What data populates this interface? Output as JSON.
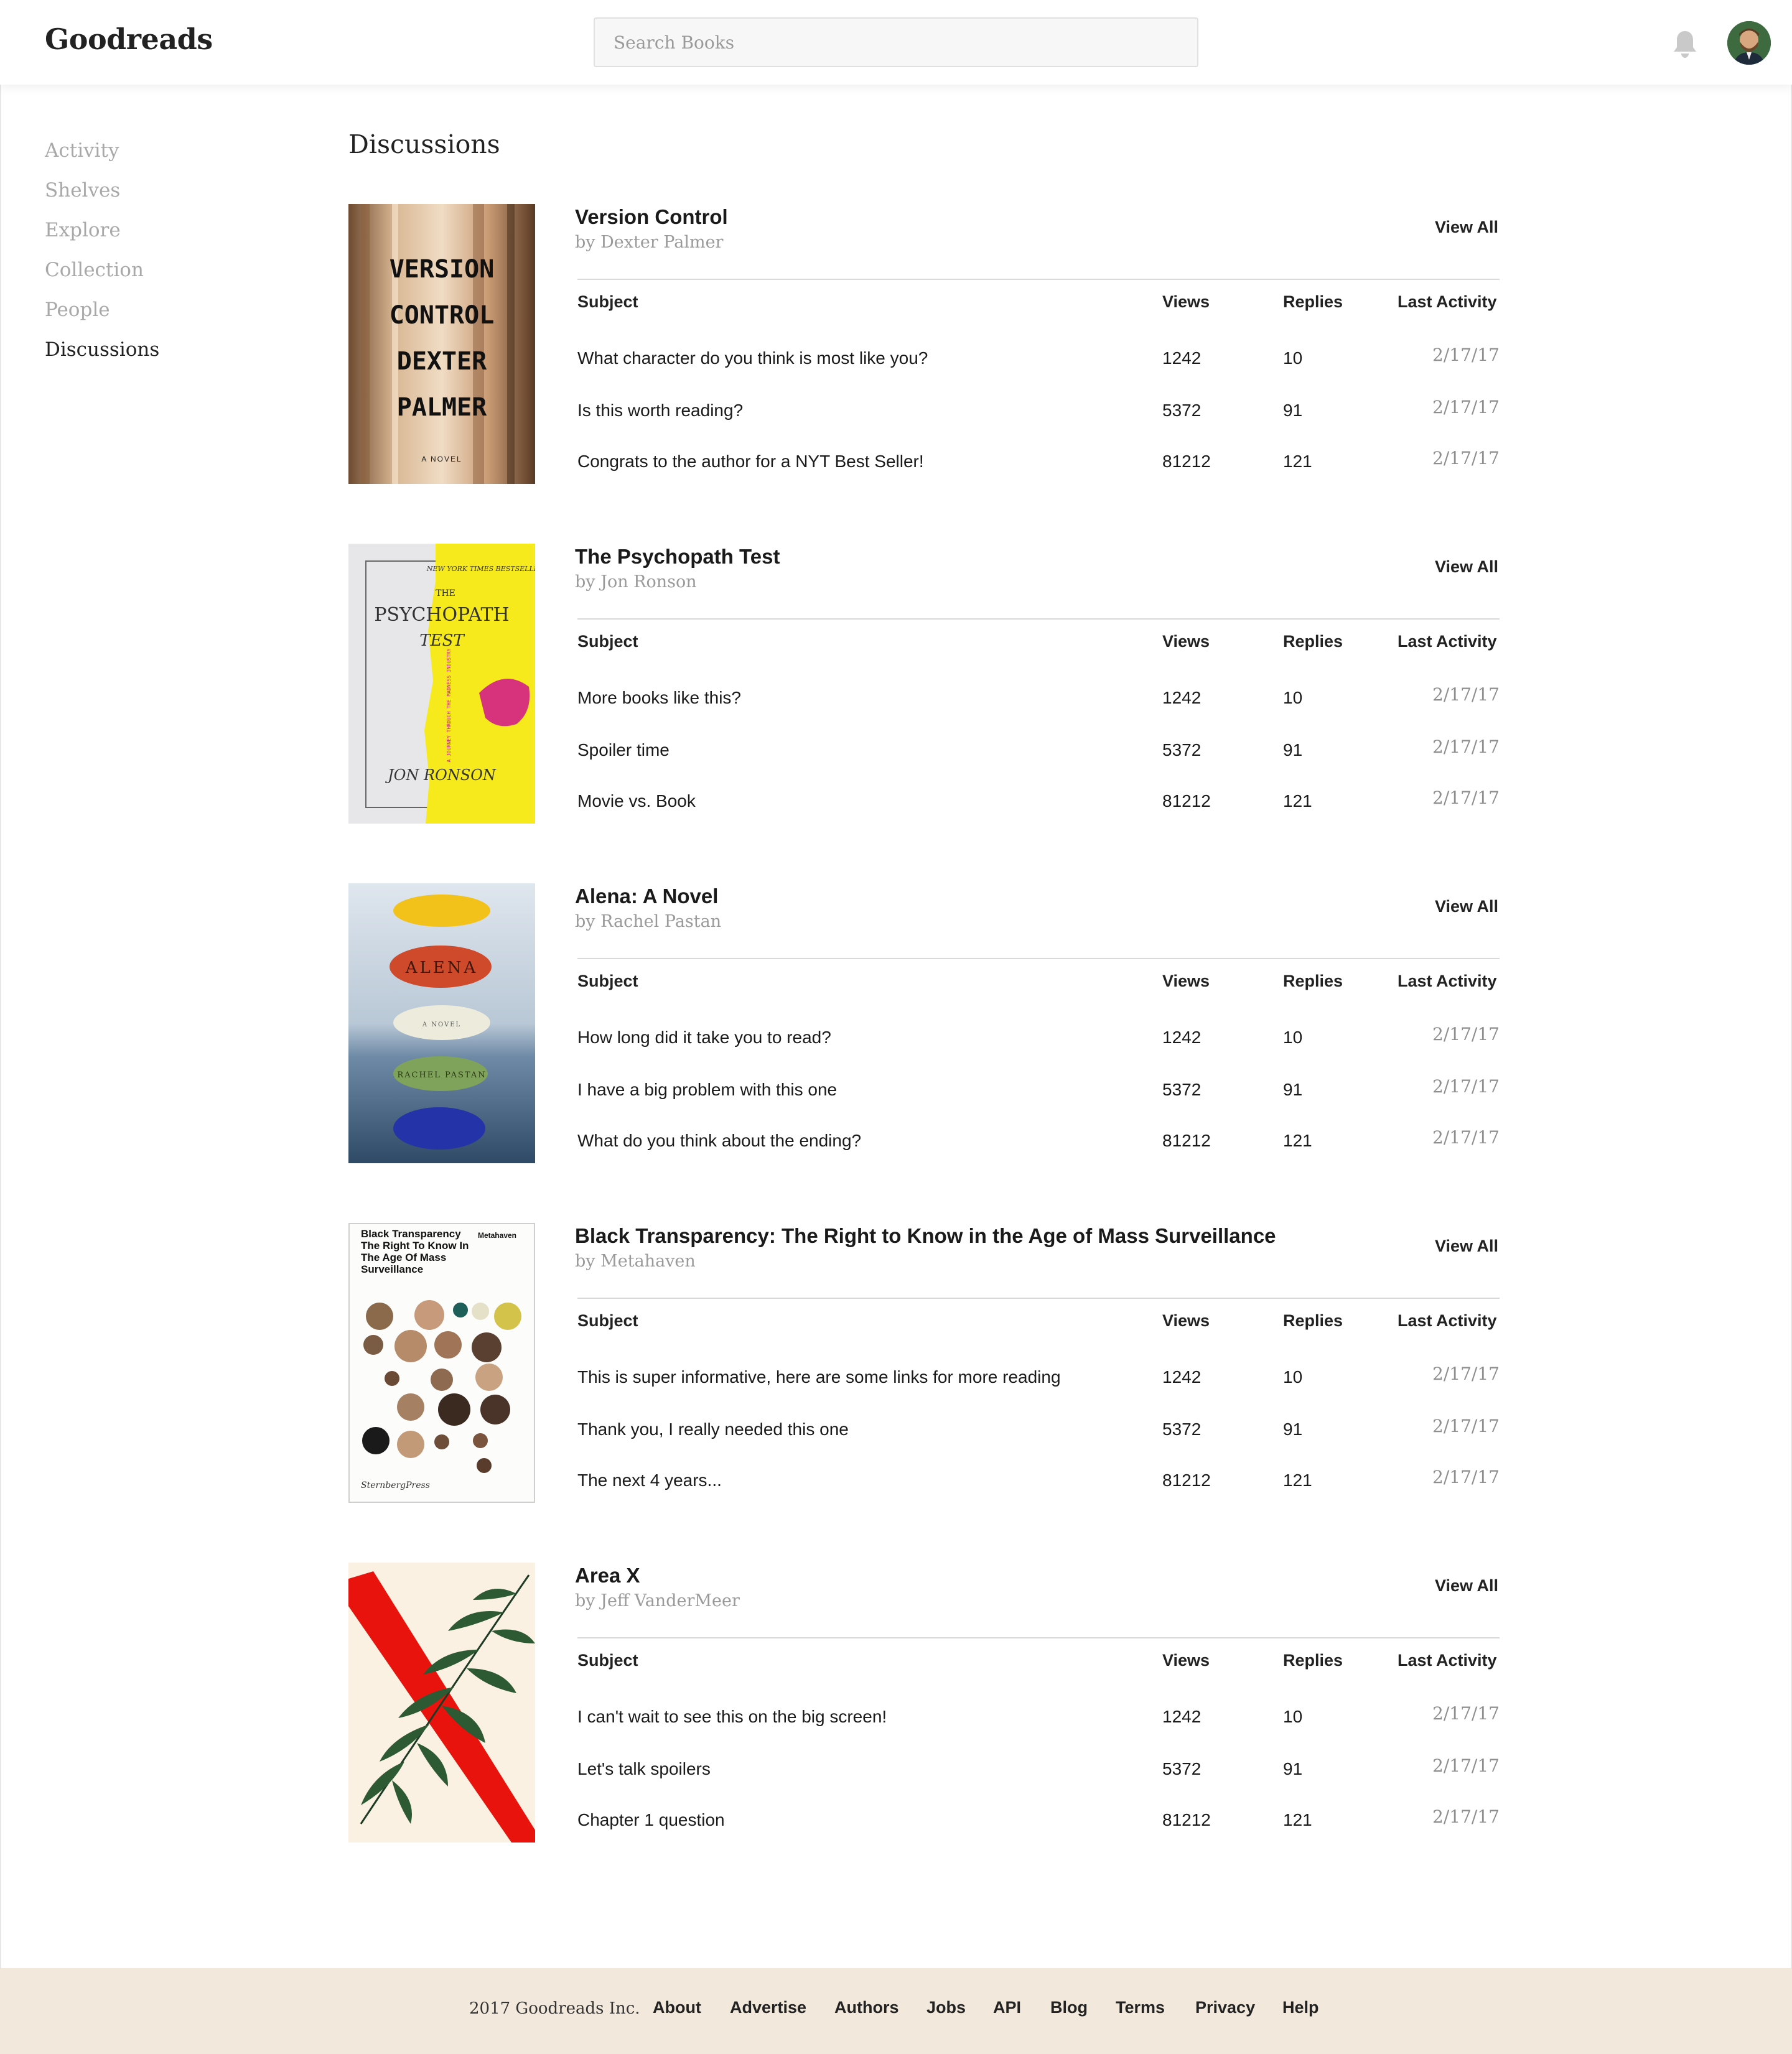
{
  "header": {
    "logo": "Goodreads",
    "search_placeholder": "Search Books"
  },
  "sidebar": {
    "items": [
      {
        "label": "Activity"
      },
      {
        "label": "Shelves"
      },
      {
        "label": "Explore"
      },
      {
        "label": "Collection"
      },
      {
        "label": "People"
      },
      {
        "label": "Discussions",
        "active": true
      }
    ]
  },
  "main": {
    "title": "Discussions",
    "columns": {
      "subject": "Subject",
      "views": "Views",
      "replies": "Replies",
      "last_activity": "Last Activity"
    },
    "view_all_label": "View All",
    "books": [
      {
        "title": "Version Control",
        "author": "by Dexter Palmer",
        "cover_text": [
          "VERSION",
          "CONTROL",
          "DEXTER",
          "PALMER",
          "A NOVEL"
        ],
        "threads": [
          {
            "subject": "What character do you think is most like you?",
            "views": "1242",
            "replies": "10",
            "last": "2/17/17"
          },
          {
            "subject": "Is this worth reading?",
            "views": "5372",
            "replies": "91",
            "last": "2/17/17"
          },
          {
            "subject": "Congrats to the author for a NYT Best Seller!",
            "views": "81212",
            "replies": "121",
            "last": "2/17/17"
          }
        ]
      },
      {
        "title": "The Psychopath Test",
        "author": "by Jon Ronson",
        "cover_text": [
          "NEW YORK TIMES BESTSELLER",
          "THE",
          "PSYCHOPATH",
          "TEST",
          "A JOURNEY THROUGH THE MADNESS INDUSTRY",
          "JON RONSON"
        ],
        "threads": [
          {
            "subject": "More books like this?",
            "views": "1242",
            "replies": "10",
            "last": "2/17/17"
          },
          {
            "subject": "Spoiler time",
            "views": "5372",
            "replies": "91",
            "last": "2/17/17"
          },
          {
            "subject": "Movie vs. Book",
            "views": "81212",
            "replies": "121",
            "last": "2/17/17"
          }
        ]
      },
      {
        "title": "Alena: A Novel",
        "author": "by Rachel Pastan",
        "cover_text": [
          "ALENA",
          "A NOVEL",
          "RACHEL PASTAN"
        ],
        "threads": [
          {
            "subject": "How long did it take you to read?",
            "views": "1242",
            "replies": "10",
            "last": "2/17/17"
          },
          {
            "subject": "I have a big problem with this one",
            "views": "5372",
            "replies": "91",
            "last": "2/17/17"
          },
          {
            "subject": "What do you think about the ending?",
            "views": "81212",
            "replies": "121",
            "last": "2/17/17"
          }
        ]
      },
      {
        "title": "Black Transparency: The Right to Know in the Age of Mass Surveillance",
        "author": "by Metahaven",
        "cover_text": [
          "Black Transparency The Right To Know In The Age Of Mass Surveillance",
          "Metahaven",
          "SternbergPress"
        ],
        "threads": [
          {
            "subject": "This is super informative, here are some links for more reading",
            "views": "1242",
            "replies": "10",
            "last": "2/17/17"
          },
          {
            "subject": "Thank you, I really needed this one",
            "views": "5372",
            "replies": "91",
            "last": "2/17/17"
          },
          {
            "subject": "The next 4 years...",
            "views": "81212",
            "replies": "121",
            "last": "2/17/17"
          }
        ]
      },
      {
        "title": "Area X",
        "author": "by Jeff VanderMeer",
        "cover_text": [],
        "threads": [
          {
            "subject": "I can't wait to see this on the big screen!",
            "views": "1242",
            "replies": "10",
            "last": "2/17/17"
          },
          {
            "subject": "Let's talk spoilers",
            "views": "5372",
            "replies": "91",
            "last": "2/17/17"
          },
          {
            "subject": "Chapter 1 question",
            "views": "81212",
            "replies": "121",
            "last": "2/17/17"
          }
        ]
      }
    ]
  },
  "footer": {
    "copyright": "2017 Goodreads Inc.",
    "links": [
      "About",
      "Advertise",
      "Authors",
      "Jobs",
      "API",
      "Blog",
      "Terms",
      "Privacy",
      "Help"
    ]
  },
  "colors": {
    "footer_bg": "#f2e9dc",
    "nav_inactive": "#a8a8a8",
    "date_text": "#8e8e8e"
  }
}
